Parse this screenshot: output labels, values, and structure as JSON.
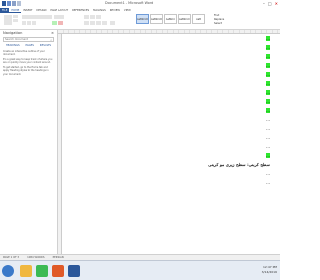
{
  "window": {
    "title": "Document1 - Microsoft Word",
    "controls": [
      "–",
      "□",
      "✕"
    ]
  },
  "quick_access": [
    "word-logo-icon",
    "save-icon",
    "undo-icon",
    "redo-icon"
  ],
  "ribbon_tabs": [
    "FILE",
    "HOME",
    "INSERT",
    "DESIGN",
    "PAGE LAYOUT",
    "REFERENCES",
    "MAILINGS",
    "REVIEW",
    "VIEW"
  ],
  "styles_gallery": [
    "AaBbCcDc",
    "AaBbCcDc",
    "AaBbCc",
    "AaBbCcC",
    "AaB",
    "AaBbCcC"
  ],
  "editing": [
    "Find",
    "Replace",
    "Select"
  ],
  "navigation": {
    "title": "Navigation",
    "close": "×",
    "search_placeholder": "Search document",
    "tabs": [
      "HEADINGS",
      "PAGES",
      "RESULTS"
    ],
    "help_text": [
      "Create an interactive outline of your document.",
      "It's a great way to keep track of where you are or quickly move your content around.",
      "To get started, go to the Home tab and apply Heading styles to the headings in your document."
    ]
  },
  "document": {
    "lines": [
      {
        "text": "...",
        "highlight": true,
        "heading": false
      },
      {
        "text": "...",
        "highlight": true,
        "heading": false
      },
      {
        "text": "...",
        "highlight": true,
        "heading": false
      },
      {
        "text": "...",
        "highlight": true,
        "heading": false
      },
      {
        "text": "...",
        "highlight": true,
        "heading": false
      },
      {
        "text": "...",
        "highlight": true,
        "heading": false
      },
      {
        "text": "...",
        "highlight": true,
        "heading": false
      },
      {
        "text": "...",
        "highlight": true,
        "heading": false
      },
      {
        "text": "...",
        "highlight": true,
        "heading": false
      },
      {
        "text": "...",
        "highlight": false,
        "heading": false
      },
      {
        "text": "...",
        "highlight": false,
        "heading": false
      },
      {
        "text": "...",
        "highlight": false,
        "heading": false
      },
      {
        "text": "...",
        "highlight": false,
        "heading": false
      },
      {
        "text": "...",
        "highlight": true,
        "heading": false
      },
      {
        "text": "سطح کربنی: سطح زیری مو کربنی",
        "highlight": false,
        "heading": true
      },
      {
        "text": "...",
        "highlight": false,
        "heading": false
      },
      {
        "text": "...",
        "highlight": false,
        "heading": false
      }
    ]
  },
  "status": {
    "page": "PAGE 1 OF 3",
    "words": "1084 WORDS",
    "language": "PERSIAN"
  },
  "taskbar": {
    "apps": [
      {
        "name": "explorer",
        "color": "#f0b840"
      },
      {
        "name": "chrome",
        "color": "#3cba54"
      },
      {
        "name": "media",
        "color": "#e05a28"
      },
      {
        "name": "word",
        "color": "#2b579a"
      }
    ],
    "clock": {
      "time": "12:47 PM",
      "date": "3/14/2016"
    }
  },
  "colors": {
    "highlight": "#2ee82e",
    "word_blue": "#2b579a"
  }
}
